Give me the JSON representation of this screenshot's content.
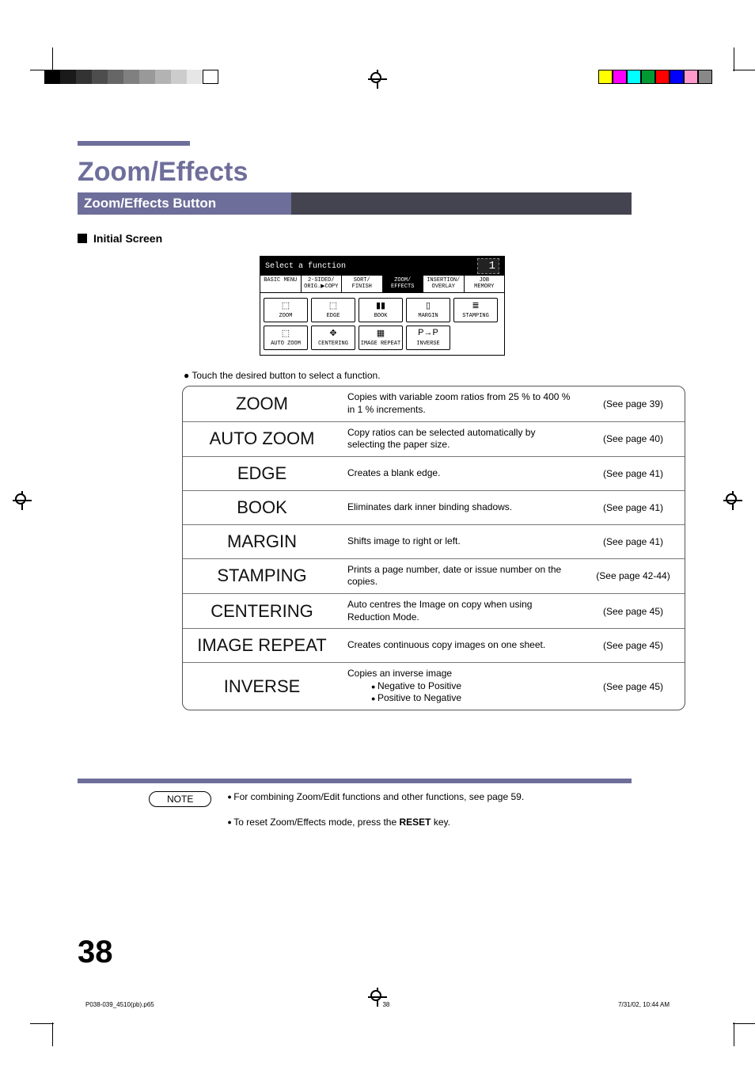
{
  "page_number": "38",
  "title": "Zoom/Effects",
  "subhead": "Zoom/Effects Button",
  "initial_screen_label": "Initial Screen",
  "lcd": {
    "prompt": "Select a function",
    "count": "1",
    "tabs": [
      "BASIC MENU",
      "2-SIDED/\nORIG.▶COPY",
      "SORT/\nFINISH",
      "ZOOM/\nEFFECTS",
      "INSERTION/\nOVERLAY",
      "JOB\nMEMORY"
    ],
    "active_tab_index": 3,
    "buttons_row1": [
      {
        "label": "ZOOM",
        "icon": "⬚"
      },
      {
        "label": "EDGE",
        "icon": "⬚"
      },
      {
        "label": "BOOK",
        "icon": "▮▮"
      },
      {
        "label": "MARGIN",
        "icon": "▯"
      },
      {
        "label": "STAMPING",
        "icon": "≣"
      }
    ],
    "buttons_row2": [
      {
        "label": "AUTO ZOOM",
        "icon": "⬚"
      },
      {
        "label": "CENTERING",
        "icon": "✥"
      },
      {
        "label": "IMAGE REPEAT",
        "icon": "▦"
      },
      {
        "label": "INVERSE",
        "icon": "P→P"
      }
    ]
  },
  "touch_note": "Touch the desired button to select a function.",
  "functions": [
    {
      "name": "ZOOM",
      "desc": "Copies with variable zoom ratios from 25 % to 400 % in 1 % increments.",
      "ref": "(See page 39)"
    },
    {
      "name": "AUTO ZOOM",
      "desc": "Copy ratios can be selected automatically by selecting the paper size.",
      "ref": "(See page 40)"
    },
    {
      "name": "EDGE",
      "desc": "Creates a blank edge.",
      "ref": "(See page 41)"
    },
    {
      "name": "BOOK",
      "desc": "Eliminates dark inner binding shadows.",
      "ref": "(See page 41)"
    },
    {
      "name": "MARGIN",
      "desc": "Shifts image to right or left.",
      "ref": "(See page 41)"
    },
    {
      "name": "STAMPING",
      "desc": "Prints a page number, date or issue number on the copies.",
      "ref": "(See page 42-44)"
    },
    {
      "name": "CENTERING",
      "desc": "Auto centres the Image on copy when using Reduction Mode.",
      "ref": "(See page 45)"
    },
    {
      "name": "IMAGE REPEAT",
      "desc": "Creates continuous copy images on one sheet.",
      "ref": "(See page 45)"
    },
    {
      "name": "INVERSE",
      "desc": "Copies an inverse image",
      "sub": [
        "Negative to Positive",
        "Positive to Negative"
      ],
      "ref": "(See page 45)"
    }
  ],
  "note_label": "NOTE",
  "notes": [
    "For combining Zoom/Edit functions and other functions, see page 59.",
    "To reset Zoom/Effects mode, press the RESET key."
  ],
  "footer": {
    "file": "P038-039_4510(pb).p65",
    "page": "38",
    "date": "7/31/02, 10:44 AM"
  },
  "gray_strip_colors": [
    "#000",
    "#1a1a1a",
    "#333",
    "#4d4d4d",
    "#666",
    "#808080",
    "#999",
    "#b3b3b3",
    "#ccc",
    "#e6e6e6",
    "#fff"
  ],
  "color_strip_colors": [
    "#ffff00",
    "#ff00ff",
    "#00ffff",
    "#009933",
    "#ff0000",
    "#0000ff",
    "#ff99cc",
    "#888888"
  ]
}
